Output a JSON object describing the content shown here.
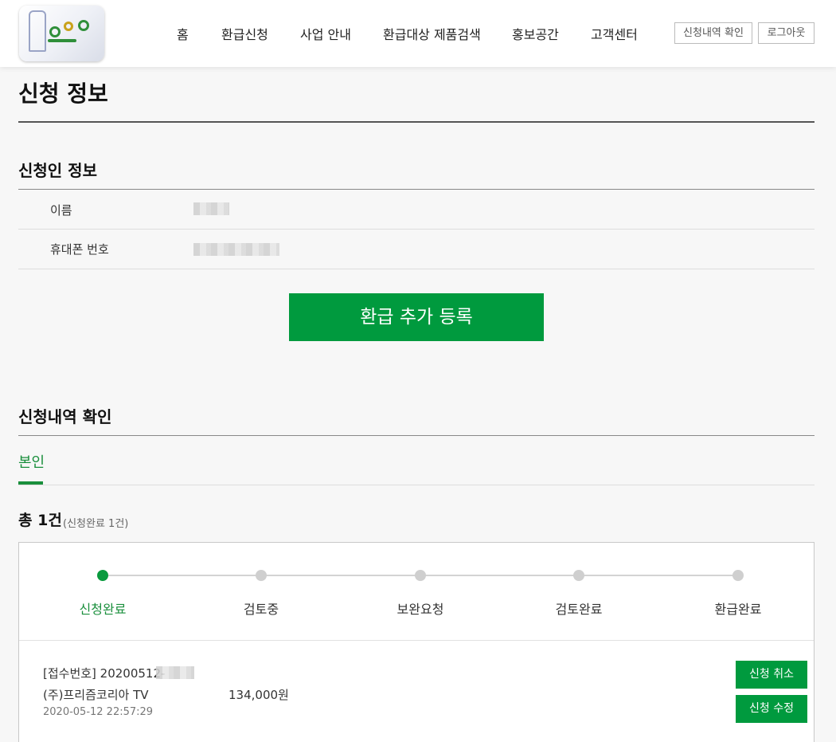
{
  "header": {
    "nav": [
      "홈",
      "환급신청",
      "사업 안내",
      "환급대상 제품검색",
      "홍보공간",
      "고객센터"
    ],
    "history_button": "신청내역 확인",
    "logout_button": "로그아웃"
  },
  "page_title": "신청 정보",
  "applicant": {
    "section_title": "신청인 정보",
    "name_label": "이름",
    "phone_label": "휴대폰 번호"
  },
  "add_refund_button": "환급 추가 등록",
  "history": {
    "section_title": "신청내역 확인",
    "tab_label": "본인",
    "total_label": "총 1건",
    "total_sub": "(신청완료 1건)",
    "steps": [
      "신청완료",
      "검토중",
      "보완요청",
      "검토완료",
      "환급완료"
    ],
    "active_step_index": 0,
    "record": {
      "receipt_line": "[접수번호] 20200512-",
      "product_line": "(주)프리즘코리아   TV",
      "amount": "134,000원",
      "date": "2020-05-12 22:57:29",
      "cancel_button": "신청 취소",
      "edit_button": "신청 수정"
    }
  },
  "colors": {
    "accent": "#009a3e",
    "accent_text": "#1a8f3c",
    "inactive_step": "#cfcfcf"
  }
}
